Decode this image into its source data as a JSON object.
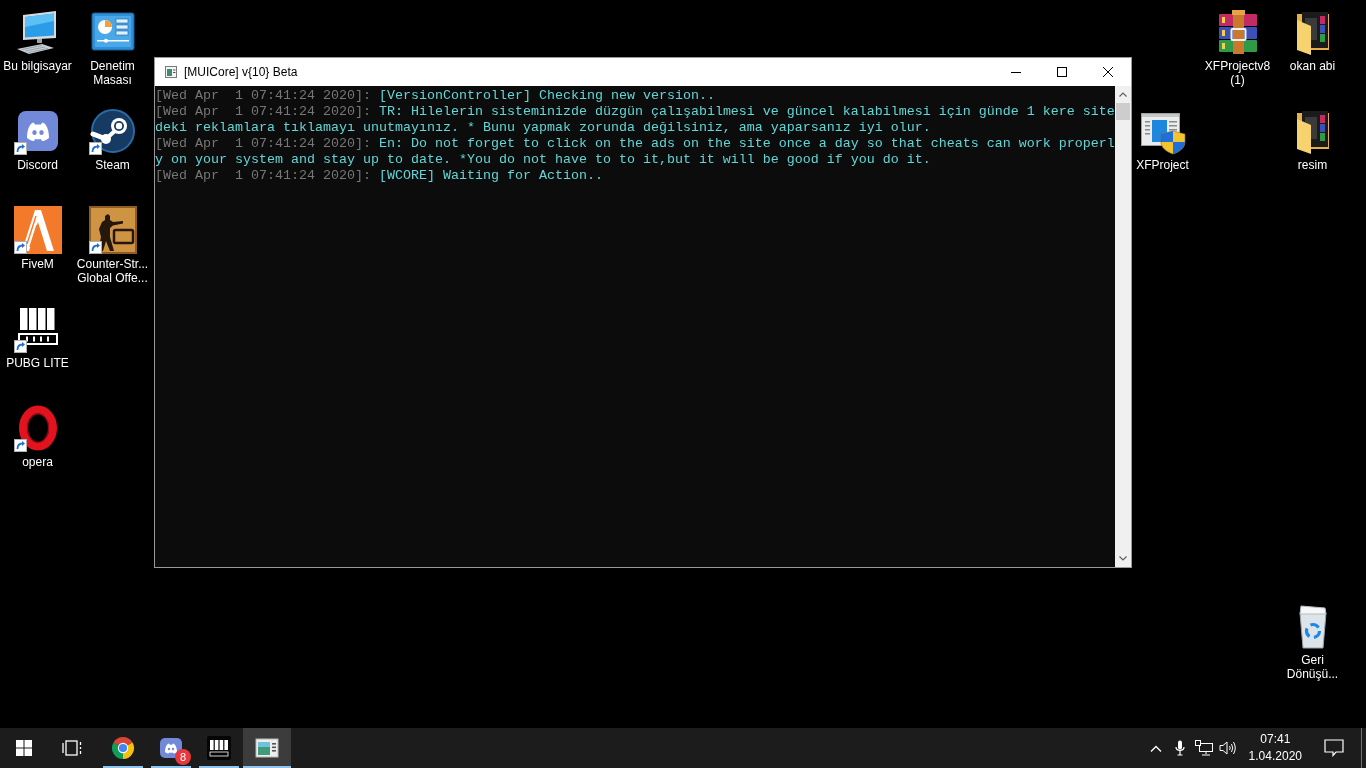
{
  "desktop": {
    "icons": [
      {
        "label": "Bu bilgisayar",
        "kind": "computer",
        "shortcut": false
      },
      {
        "label": "Denetim Masası",
        "kind": "control-panel",
        "shortcut": false
      },
      {
        "label": "Discord",
        "kind": "discord",
        "shortcut": true
      },
      {
        "label": "Steam",
        "kind": "steam",
        "shortcut": true
      },
      {
        "label": "FiveM",
        "kind": "fivem",
        "shortcut": true
      },
      {
        "label": "Counter-Str... Global Offe...",
        "kind": "csgo",
        "shortcut": true
      },
      {
        "label": "PUBG LITE",
        "kind": "pubg",
        "shortcut": true
      },
      {
        "label": "opera",
        "kind": "opera",
        "shortcut": true
      },
      {
        "label": "XFProjectv8 (1)",
        "kind": "archive",
        "shortcut": false
      },
      {
        "label": "okan abi",
        "kind": "folder",
        "shortcut": false
      },
      {
        "label": "XFProject",
        "kind": "installer",
        "shortcut": false
      },
      {
        "label": "resim",
        "kind": "folder",
        "shortcut": false
      },
      {
        "label": "Geri Dönüşü...",
        "kind": "recycle-bin",
        "shortcut": false
      }
    ]
  },
  "console_window": {
    "title": "[MUICore] v{10} Beta",
    "lines": [
      {
        "timestamp": "[Wed Apr  1 07:41:24 2020]:",
        "message": "[VersionController] Checking new version.."
      },
      {
        "timestamp": "[Wed Apr  1 07:41:24 2020]:",
        "message": "TR: Hilelerin sisteminizde düzgün çalışabilmesi ve güncel kalabilmesi için günde 1 kere sitedeki reklamlara tıklamayı unutmayınız. * Bunu yapmak zorunda değilsiniz, ama yaparsanız iyi olur."
      },
      {
        "timestamp": "[Wed Apr  1 07:41:24 2020]:",
        "message": "En: Do not forget to click on the ads on the site once a day so that cheats can work properly on your system and stay up to date. *You do not have to to it,but it will be good if you do it."
      },
      {
        "timestamp": "[Wed Apr  1 07:41:24 2020]:",
        "message": "[WCORE] Waiting for Action.."
      }
    ]
  },
  "taskbar": {
    "apps": [
      {
        "kind": "chrome",
        "running": true,
        "selected": false
      },
      {
        "kind": "discord",
        "running": true,
        "selected": false,
        "badge": "8"
      },
      {
        "kind": "pubg",
        "running": true,
        "selected": false
      },
      {
        "kind": "console",
        "running": true,
        "selected": true
      }
    ],
    "clock": {
      "time": "07:41",
      "date": "1.04.2020"
    }
  }
}
